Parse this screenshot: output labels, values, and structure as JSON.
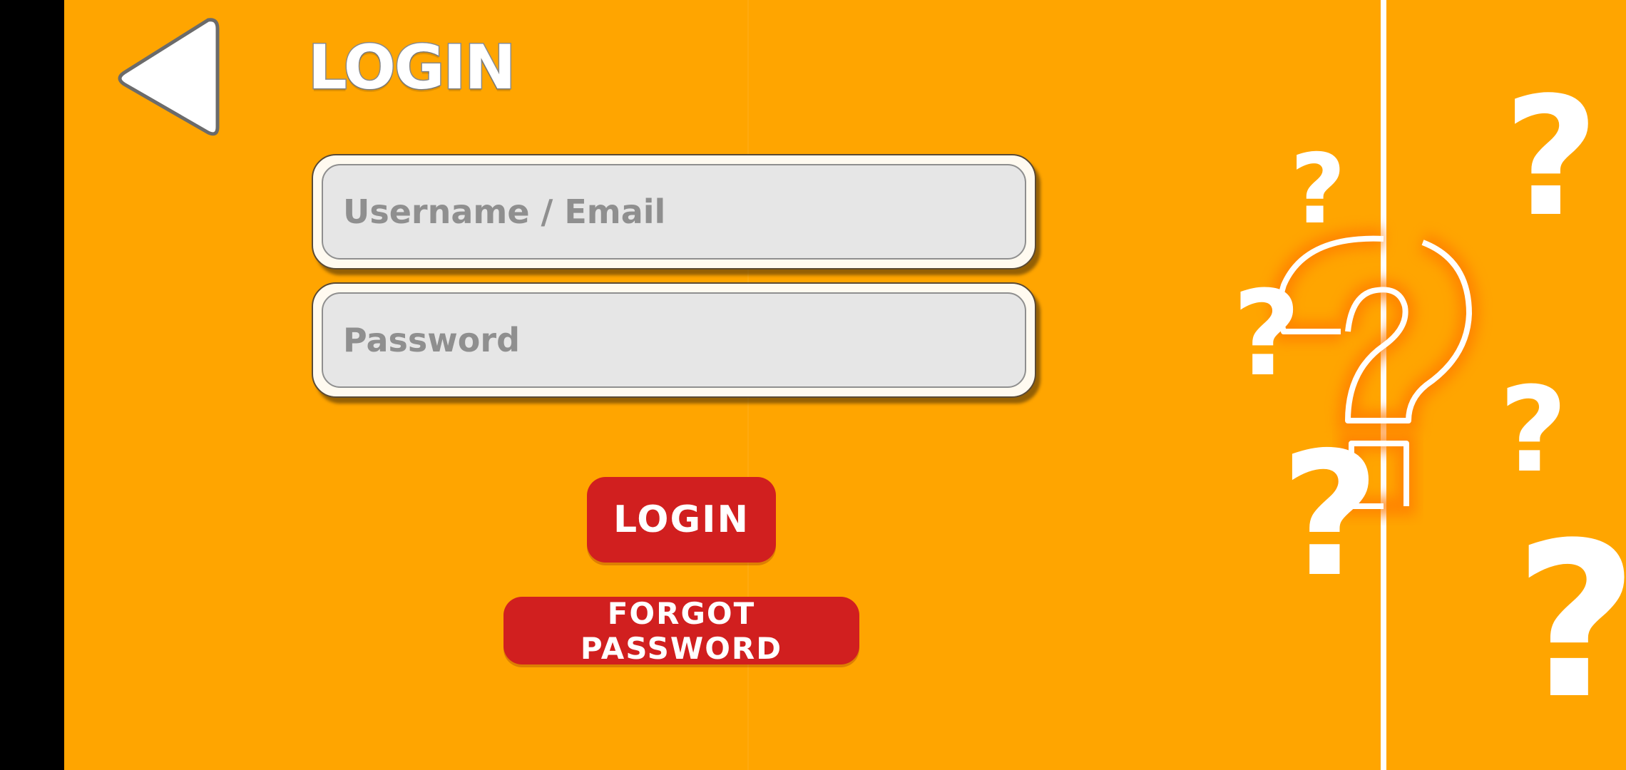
{
  "screen": {
    "title": "LOGIN",
    "background_color": "#FFA500",
    "accent_color": "#D11F1F"
  },
  "back": {
    "icon": "triangle-back-icon"
  },
  "form": {
    "username": {
      "value": "",
      "placeholder": "Username / Email"
    },
    "password": {
      "value": "",
      "placeholder": "Password"
    }
  },
  "buttons": {
    "login_label": "LOGIN",
    "forgot_label": "FORGOT PASSWORD"
  },
  "decoration": {
    "glyph": "?",
    "icon": "question-mark-icon"
  }
}
